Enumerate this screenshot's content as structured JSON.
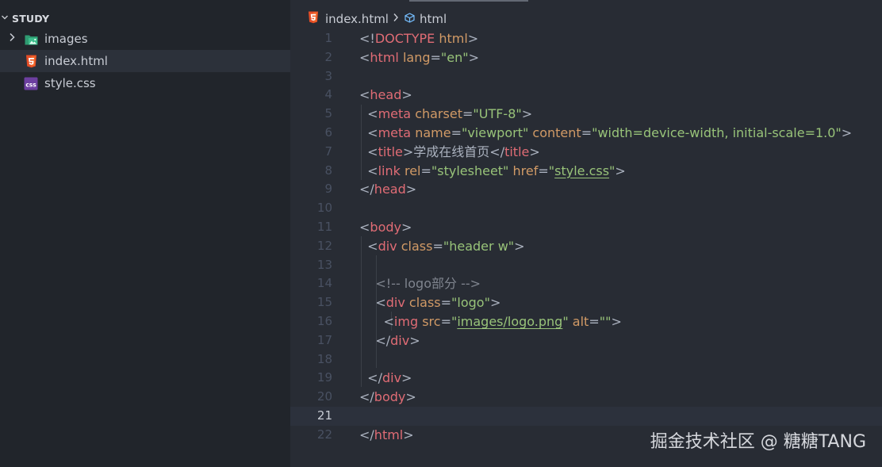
{
  "explorer": {
    "title": "STUDY",
    "items": [
      {
        "label": "images",
        "type": "folder",
        "icon": "folder-images-icon"
      },
      {
        "label": "index.html",
        "type": "html",
        "icon": "html5-icon",
        "selected": true
      },
      {
        "label": "style.css",
        "type": "css",
        "icon": "css-icon",
        "badge": "css"
      }
    ]
  },
  "breadcrumb": {
    "file": "index.html",
    "symbol": "html"
  },
  "editor": {
    "current_line": 21,
    "lines": [
      {
        "n": "1",
        "tokens": [
          [
            "p",
            "<!"
          ],
          [
            "t",
            "DOCTYPE"
          ],
          [
            "p",
            " "
          ],
          [
            "a",
            "html"
          ],
          [
            "p",
            ">"
          ]
        ]
      },
      {
        "n": "2",
        "tokens": [
          [
            "p",
            "<"
          ],
          [
            "t",
            "html"
          ],
          [
            "p",
            " "
          ],
          [
            "a",
            "lang"
          ],
          [
            "p",
            "="
          ],
          [
            "s",
            "\"en\""
          ],
          [
            "p",
            ">"
          ]
        ]
      },
      {
        "n": "3",
        "tokens": []
      },
      {
        "n": "4",
        "tokens": [
          [
            "p",
            "<"
          ],
          [
            "t",
            "head"
          ],
          [
            "p",
            ">"
          ]
        ]
      },
      {
        "n": "5",
        "tokens": [
          [
            "p",
            "  <"
          ],
          [
            "t",
            "meta"
          ],
          [
            "p",
            " "
          ],
          [
            "a",
            "charset"
          ],
          [
            "p",
            "="
          ],
          [
            "s",
            "\"UTF-8\""
          ],
          [
            "p",
            ">"
          ]
        ]
      },
      {
        "n": "6",
        "tokens": [
          [
            "p",
            "  <"
          ],
          [
            "t",
            "meta"
          ],
          [
            "p",
            " "
          ],
          [
            "a",
            "name"
          ],
          [
            "p",
            "="
          ],
          [
            "s",
            "\"viewport\""
          ],
          [
            "p",
            " "
          ],
          [
            "a",
            "content"
          ],
          [
            "p",
            "="
          ],
          [
            "s",
            "\"width=device-width, initial-scale=1.0\""
          ],
          [
            "p",
            ">"
          ]
        ]
      },
      {
        "n": "7",
        "tokens": [
          [
            "p",
            "  <"
          ],
          [
            "t",
            "title"
          ],
          [
            "p",
            ">"
          ],
          [
            "x",
            "学成在线首页"
          ],
          [
            "p",
            "</"
          ],
          [
            "t",
            "title"
          ],
          [
            "p",
            ">"
          ]
        ]
      },
      {
        "n": "8",
        "tokens": [
          [
            "p",
            "  <"
          ],
          [
            "t",
            "link"
          ],
          [
            "p",
            " "
          ],
          [
            "a",
            "rel"
          ],
          [
            "p",
            "="
          ],
          [
            "s",
            "\"stylesheet\""
          ],
          [
            "p",
            " "
          ],
          [
            "a",
            "href"
          ],
          [
            "p",
            "="
          ],
          [
            "s",
            "\""
          ],
          [
            "su",
            "style.css"
          ],
          [
            "s",
            "\""
          ],
          [
            "p",
            ">"
          ]
        ]
      },
      {
        "n": "9",
        "tokens": [
          [
            "p",
            "</"
          ],
          [
            "t",
            "head"
          ],
          [
            "p",
            ">"
          ]
        ]
      },
      {
        "n": "10",
        "tokens": []
      },
      {
        "n": "11",
        "tokens": [
          [
            "p",
            "<"
          ],
          [
            "t",
            "body"
          ],
          [
            "p",
            ">"
          ]
        ]
      },
      {
        "n": "12",
        "tokens": [
          [
            "p",
            "  <"
          ],
          [
            "t",
            "div"
          ],
          [
            "p",
            " "
          ],
          [
            "a",
            "class"
          ],
          [
            "p",
            "="
          ],
          [
            "s",
            "\"header w\""
          ],
          [
            "p",
            ">"
          ]
        ]
      },
      {
        "n": "13",
        "tokens": []
      },
      {
        "n": "14",
        "tokens": [
          [
            "c",
            "    <!-- logo部分 -->"
          ]
        ]
      },
      {
        "n": "15",
        "tokens": [
          [
            "p",
            "    <"
          ],
          [
            "t",
            "div"
          ],
          [
            "p",
            " "
          ],
          [
            "a",
            "class"
          ],
          [
            "p",
            "="
          ],
          [
            "s",
            "\"logo\""
          ],
          [
            "p",
            ">"
          ]
        ]
      },
      {
        "n": "16",
        "tokens": [
          [
            "p",
            "      <"
          ],
          [
            "t",
            "img"
          ],
          [
            "p",
            " "
          ],
          [
            "a",
            "src"
          ],
          [
            "p",
            "="
          ],
          [
            "s",
            "\""
          ],
          [
            "su",
            "images/logo.png"
          ],
          [
            "s",
            "\""
          ],
          [
            "p",
            " "
          ],
          [
            "a",
            "alt"
          ],
          [
            "p",
            "="
          ],
          [
            "s",
            "\"\""
          ],
          [
            "p",
            ">"
          ]
        ]
      },
      {
        "n": "17",
        "tokens": [
          [
            "p",
            "    </"
          ],
          [
            "t",
            "div"
          ],
          [
            "p",
            ">"
          ]
        ]
      },
      {
        "n": "18",
        "tokens": []
      },
      {
        "n": "19",
        "tokens": [
          [
            "p",
            "  </"
          ],
          [
            "t",
            "div"
          ],
          [
            "p",
            ">"
          ]
        ]
      },
      {
        "n": "20",
        "tokens": [
          [
            "p",
            "</"
          ],
          [
            "t",
            "body"
          ],
          [
            "p",
            ">"
          ]
        ]
      },
      {
        "n": "21",
        "tokens": []
      },
      {
        "n": "22",
        "tokens": [
          [
            "p",
            "</"
          ],
          [
            "t",
            "html"
          ],
          [
            "p",
            ">"
          ]
        ]
      }
    ]
  },
  "watermark": "掘金技术社区 @ 糖糖TANG",
  "colors": {
    "tag": "#e06c75",
    "attribute": "#d19a66",
    "string": "#98c379",
    "punctuation": "#abb2bf",
    "comment": "#7f848e",
    "html5_icon": "#e44d26",
    "css_icon": "#6d3fa0",
    "images_folder_icon": "#3dbd8c"
  }
}
